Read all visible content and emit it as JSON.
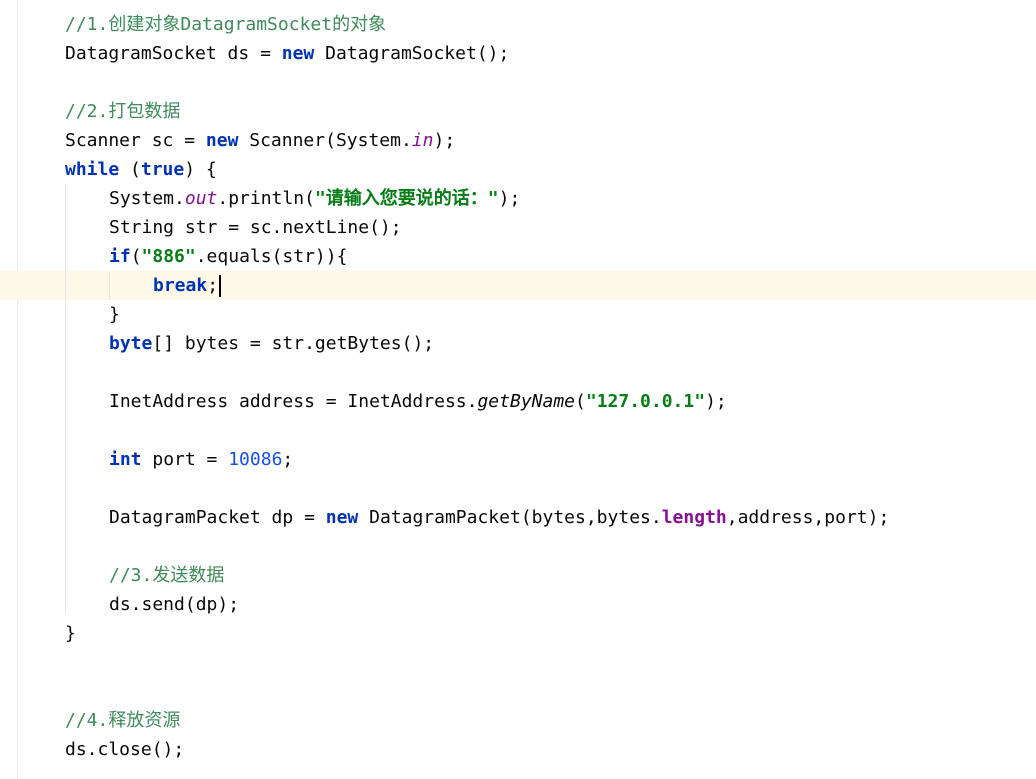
{
  "editor": {
    "lines": [
      {
        "id": 1,
        "tokens": [
          "//1.",
          "创建对象",
          "DatagramSocket",
          "的对象"
        ]
      },
      {
        "id": 2,
        "tokens": [
          "DatagramSocket ds = ",
          "new",
          " DatagramSocket();"
        ]
      },
      {
        "id": 3,
        "tokens": [
          "//2.",
          "打包数据"
        ]
      },
      {
        "id": 4,
        "tokens": [
          "Scanner sc = ",
          "new",
          " Scanner(System.",
          "in",
          ");"
        ]
      },
      {
        "id": 5,
        "tokens": [
          "while",
          " (",
          "true",
          ") {"
        ]
      },
      {
        "id": 6,
        "tokens": [
          "System.",
          "out",
          ".println(",
          "\"请输入您要说的话：\"",
          ");"
        ]
      },
      {
        "id": 7,
        "tokens": [
          "String str = sc.nextLine();"
        ]
      },
      {
        "id": 8,
        "tokens": [
          "if",
          "(",
          "\"886\"",
          ".equals(str)){"
        ]
      },
      {
        "id": 9,
        "tokens": [
          "break",
          ";"
        ]
      },
      {
        "id": 10,
        "tokens": [
          "}"
        ]
      },
      {
        "id": 11,
        "tokens": [
          "byte",
          "[] bytes = str.getBytes();"
        ]
      },
      {
        "id": 12,
        "tokens": [
          "InetAddress address = InetAddress.",
          "getByName",
          "(",
          "\"127.0.0.1\"",
          ");"
        ]
      },
      {
        "id": 13,
        "tokens": [
          "int",
          " port = ",
          "10086",
          ";"
        ]
      },
      {
        "id": 14,
        "tokens": [
          "DatagramPacket dp = ",
          "new",
          " DatagramPacket(bytes,bytes.",
          "length",
          ",address,port);"
        ]
      },
      {
        "id": 15,
        "tokens": [
          "//3.",
          "发送数据"
        ]
      },
      {
        "id": 16,
        "tokens": [
          "ds.send(dp);"
        ]
      },
      {
        "id": 17,
        "tokens": [
          "}"
        ]
      },
      {
        "id": 18,
        "tokens": [
          "//4.",
          "释放资源"
        ]
      },
      {
        "id": 19,
        "tokens": [
          "ds.close();"
        ]
      }
    ]
  },
  "colors": {
    "keyword": "#0033b3",
    "string": "#067d17",
    "number": "#1750eb",
    "comment": "#8c8c8c",
    "field": "#871094",
    "caret_line": "#fdf8e7"
  }
}
